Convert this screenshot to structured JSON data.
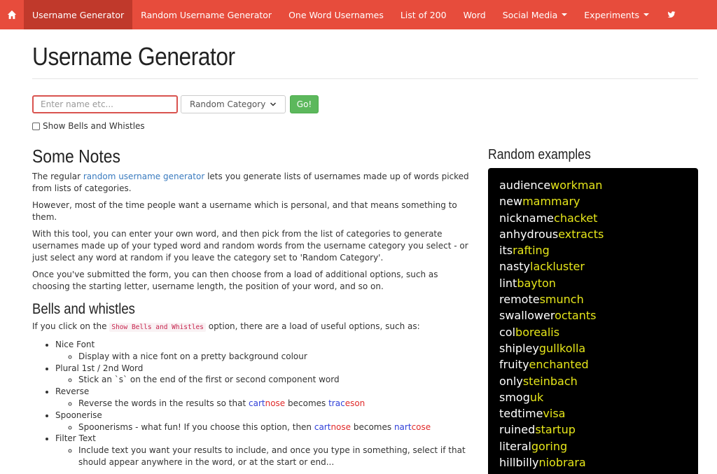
{
  "nav": {
    "items": [
      {
        "label": "Username Generator",
        "active": true
      },
      {
        "label": "Random Username Generator"
      },
      {
        "label": "One Word Usernames"
      },
      {
        "label": "List of 200"
      },
      {
        "label": "Word"
      },
      {
        "label": "Social Media",
        "dropdown": true
      },
      {
        "label": "Experiments",
        "dropdown": true
      }
    ]
  },
  "page": {
    "title": "Username Generator"
  },
  "form": {
    "input_placeholder": "Enter name etc...",
    "input_value": "",
    "category_selected": "Random Category",
    "go_label": "Go!",
    "bells_label": "Show Bells and Whistles",
    "bells_checked": false
  },
  "notes": {
    "heading": "Some Notes",
    "p1_pre": "The regular ",
    "p1_link": "random username generator",
    "p1_post": " lets you generate lists of usernames made up of words picked from lists of categories.",
    "p2": "However, most of the time people want a username which is personal, and that means something to them.",
    "p3": "With this tool, you can enter your own word, and then pick from the list of categories to generate usernames made up of your typed word and random words from the username category you select - or just select any word at random if you leave the category set to 'Random Category'.",
    "p4": "Once you've submitted the form, you can then choose from a load of additional options, such as choosing the starting letter, username length, the position of your word, and so on.",
    "bells_heading": "Bells and whistles",
    "bells_intro_pre": "If you click on the ",
    "bells_intro_code": "Show Bells and Whistles",
    "bells_intro_post": " option, there are a load of useful options, such as:",
    "options": {
      "nice_font": "Nice Font",
      "nice_font_desc": "Display with a nice font on a pretty background colour",
      "plural": "Plural 1st / 2nd Word",
      "plural_desc": "Stick an `s` on the end of the first or second component word",
      "reverse": "Reverse",
      "reverse_desc_pre": "Reverse the words in the results so that ",
      "reverse_ex1a": "cart",
      "reverse_ex1b": "nose",
      "reverse_mid": " becomes ",
      "reverse_ex2a": "trac",
      "reverse_ex2b": "eson",
      "spoonerise": "Spoonerise",
      "spoonerise_desc_pre": "Spoonerisms - what fun! If you choose this option, then ",
      "spoon_ex1a": "cart",
      "spoon_ex1b": "nose",
      "spoon_mid": " becomes ",
      "spoon_ex2a": "nart",
      "spoon_ex2b": "cose",
      "filter": "Filter Text",
      "filter_desc": "Include text you want your results to include, and once you type in something, select if that should appear anywhere in the word, or at the start or end..."
    }
  },
  "examples": {
    "heading": "Random examples",
    "items": [
      {
        "a": "audience",
        "b": "workman"
      },
      {
        "a": "new",
        "b": "mammary"
      },
      {
        "a": "nickname",
        "b": "chacket"
      },
      {
        "a": "anhydrous",
        "b": "extracts"
      },
      {
        "a": "its",
        "b": "rafting"
      },
      {
        "a": "nasty",
        "b": "lackluster"
      },
      {
        "a": "lint",
        "b": "bayton"
      },
      {
        "a": "remote",
        "b": "smunch"
      },
      {
        "a": "swallower",
        "b": "octants"
      },
      {
        "a": "col",
        "b": "borealis"
      },
      {
        "a": "shipley",
        "b": "gullkolla"
      },
      {
        "a": "fruity",
        "b": "enchanted"
      },
      {
        "a": "only",
        "b": "steinbach"
      },
      {
        "a": "smog",
        "b": "uk"
      },
      {
        "a": "tedtime",
        "b": "visa"
      },
      {
        "a": "ruined",
        "b": "startup"
      },
      {
        "a": "literal",
        "b": "goring"
      },
      {
        "a": "hillbilly",
        "b": "niobrara"
      }
    ]
  },
  "colors": {
    "navbar": "#e74c3c",
    "navbar_active": "#c0392b",
    "go_button": "#5cb85c",
    "example_highlight": "#e6e61a"
  }
}
